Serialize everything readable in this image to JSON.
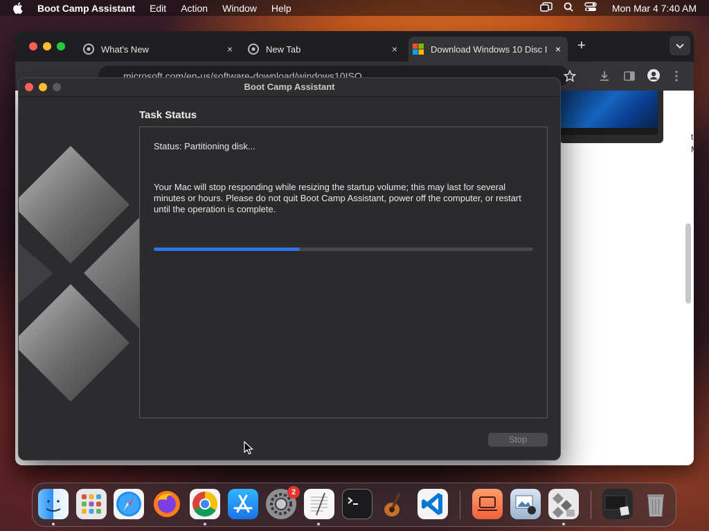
{
  "menubar": {
    "app_name": "Boot Camp Assistant",
    "menus": [
      "Edit",
      "Action",
      "Window",
      "Help"
    ],
    "clock": "Mon Mar 4  7:40 AM"
  },
  "browser": {
    "tabs": [
      {
        "label": "What's New",
        "close": "×"
      },
      {
        "label": "New Tab",
        "close": "×"
      },
      {
        "label": "Download Windows 10 Disc I",
        "close": "×"
      }
    ],
    "new_tab": "+",
    "url": "microsoft.com/en-us/software-download/windows10ISO",
    "side_text": [
      "t",
      "M"
    ]
  },
  "dialog": {
    "title": "Boot Camp Assistant",
    "heading": "Task Status",
    "status": "Status: Partitioning disk...",
    "description": "Your Mac will stop responding while resizing the startup volume; this may last for several minutes or hours. Please do not quit Boot Camp Assistant, power off the computer, or restart until the operation is complete.",
    "progress_fraction": 0.385,
    "stop_label": "Stop",
    "accent_color": "#2f74e6"
  },
  "dock": {
    "apps": [
      "Finder",
      "Launchpad",
      "Safari",
      "Firefox",
      "Google Chrome",
      "App Store",
      "System Settings",
      "TextEdit",
      "Terminal",
      "GarageBand",
      "Visual Studio Code",
      "Migration",
      "Preview",
      "Boot Camp Assistant",
      "Downloads",
      "Trash"
    ],
    "settings_badge": "2"
  }
}
